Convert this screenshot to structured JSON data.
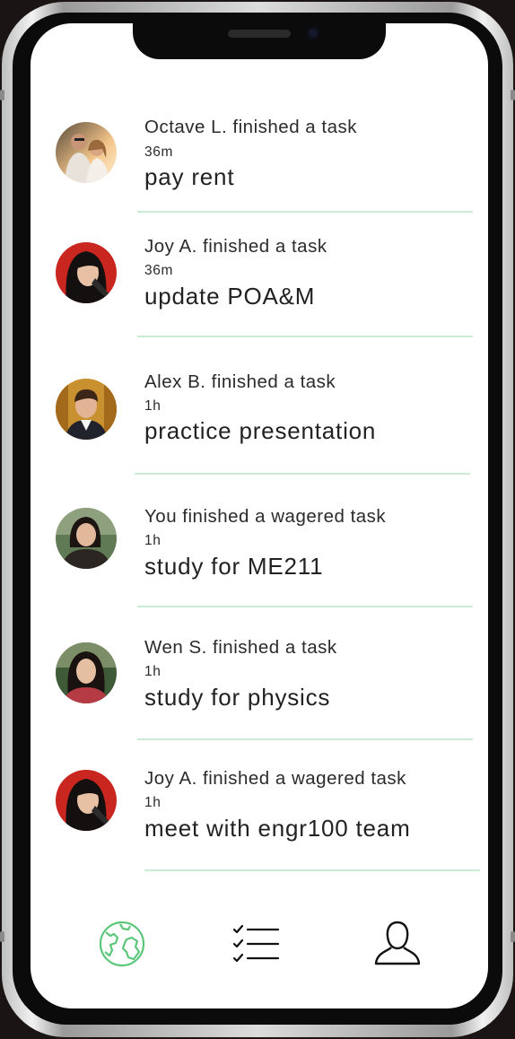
{
  "feed": [
    {
      "actor": "Octave L. finished a task",
      "time": "36m",
      "task": "pay rent",
      "avatar": "octave-avatar"
    },
    {
      "actor": "Joy A. finished a task",
      "time": "36m",
      "task": "update POA&M",
      "avatar": "joy-avatar"
    },
    {
      "actor": "Alex B. finished a task",
      "time": "1h",
      "task": "practice presentation",
      "avatar": "alex-avatar"
    },
    {
      "actor": "You finished a wagered task",
      "time": "1h",
      "task": "study for ME211",
      "avatar": "you-avatar"
    },
    {
      "actor": "Wen S. finished a task",
      "time": "1h",
      "task": "study for physics",
      "avatar": "wen-avatar"
    },
    {
      "actor": "Joy A. finished a wagered task",
      "time": "1h",
      "task": "meet with engr100 team",
      "avatar": "joy-avatar"
    }
  ],
  "tabbar": {
    "active": "feed",
    "tabs": [
      {
        "id": "feed",
        "icon": "globe-icon"
      },
      {
        "id": "tasks",
        "icon": "checklist-icon"
      },
      {
        "id": "profile",
        "icon": "user-icon"
      }
    ]
  },
  "colors": {
    "accent": "#5cc77a",
    "divider": "#c9ecd2",
    "text": "#222222"
  }
}
